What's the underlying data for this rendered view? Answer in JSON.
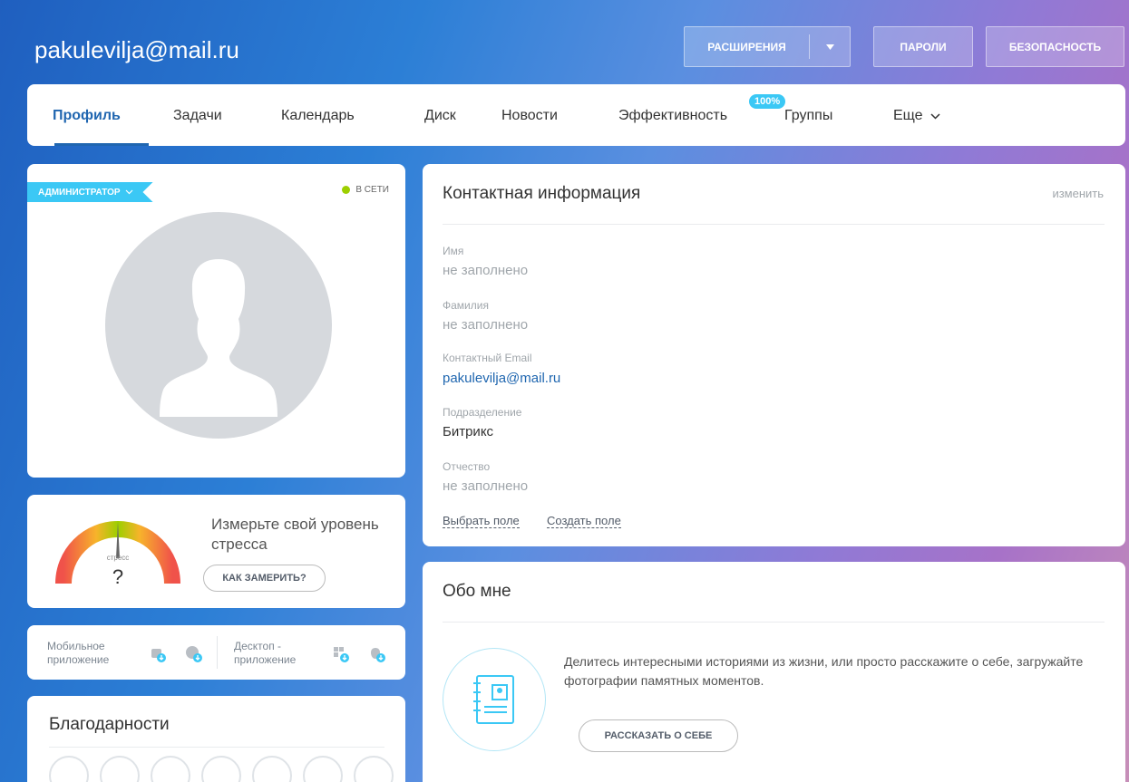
{
  "header": {
    "email": "pakulevilja@mail.ru",
    "extensions_label": "РАСШИРЕНИЯ",
    "passwords_label": "ПАРОЛИ",
    "security_label": "БЕЗОПАСНОСТЬ"
  },
  "nav": {
    "items": [
      {
        "label": "Профиль"
      },
      {
        "label": "Задачи"
      },
      {
        "label": "Календарь"
      },
      {
        "label": "Диск"
      },
      {
        "label": "Новости"
      },
      {
        "label": "Эффективность"
      },
      {
        "label": "Группы"
      },
      {
        "label": "Еще"
      }
    ],
    "efficiency_badge": "100%",
    "active_index": 0
  },
  "profile": {
    "role": "АДМИНИСТРАТОР",
    "status": "В СЕТИ",
    "status_color": "#9dcf00"
  },
  "stress": {
    "gauge_label": "стресс",
    "gauge_value": "?",
    "text": "Измерьте свой уровень стресса",
    "button": "КАК ЗАМЕРИТЬ?"
  },
  "apps": {
    "mobile_label": "Мобильное приложение",
    "desktop_label": "Десктоп - приложение",
    "icons": [
      "android-icon",
      "appstore-icon",
      "windows-icon",
      "apple-icon"
    ]
  },
  "thanks": {
    "title": "Благодарности",
    "icons": [
      "thumbs-up-icon",
      "gift-icon",
      "cup-icon",
      "money-bag-icon",
      "group-icon",
      "flower-icon",
      "cake-icon"
    ]
  },
  "contact": {
    "title": "Контактная информация",
    "edit": "изменить",
    "fields": [
      {
        "label": "Имя",
        "value": "не заполнено"
      },
      {
        "label": "Фамилия",
        "value": "не заполнено"
      },
      {
        "label": "Контактный Email",
        "value": "pakulevilja@mail.ru"
      },
      {
        "label": "Подразделение",
        "value": "Битрикс"
      },
      {
        "label": "Отчество",
        "value": "не заполнено"
      }
    ],
    "choose_field": "Выбрать поле",
    "create_field": "Создать поле"
  },
  "about": {
    "title": "Обо мне",
    "text": "Делитесь интересными историями из жизни, или просто расскажите о себе, загружайте фотографии памятных моментов.",
    "button": "РАССКАЗАТЬ О СЕБЕ"
  },
  "colors": {
    "accent": "#2066b0",
    "badge": "#3bc8f5"
  }
}
